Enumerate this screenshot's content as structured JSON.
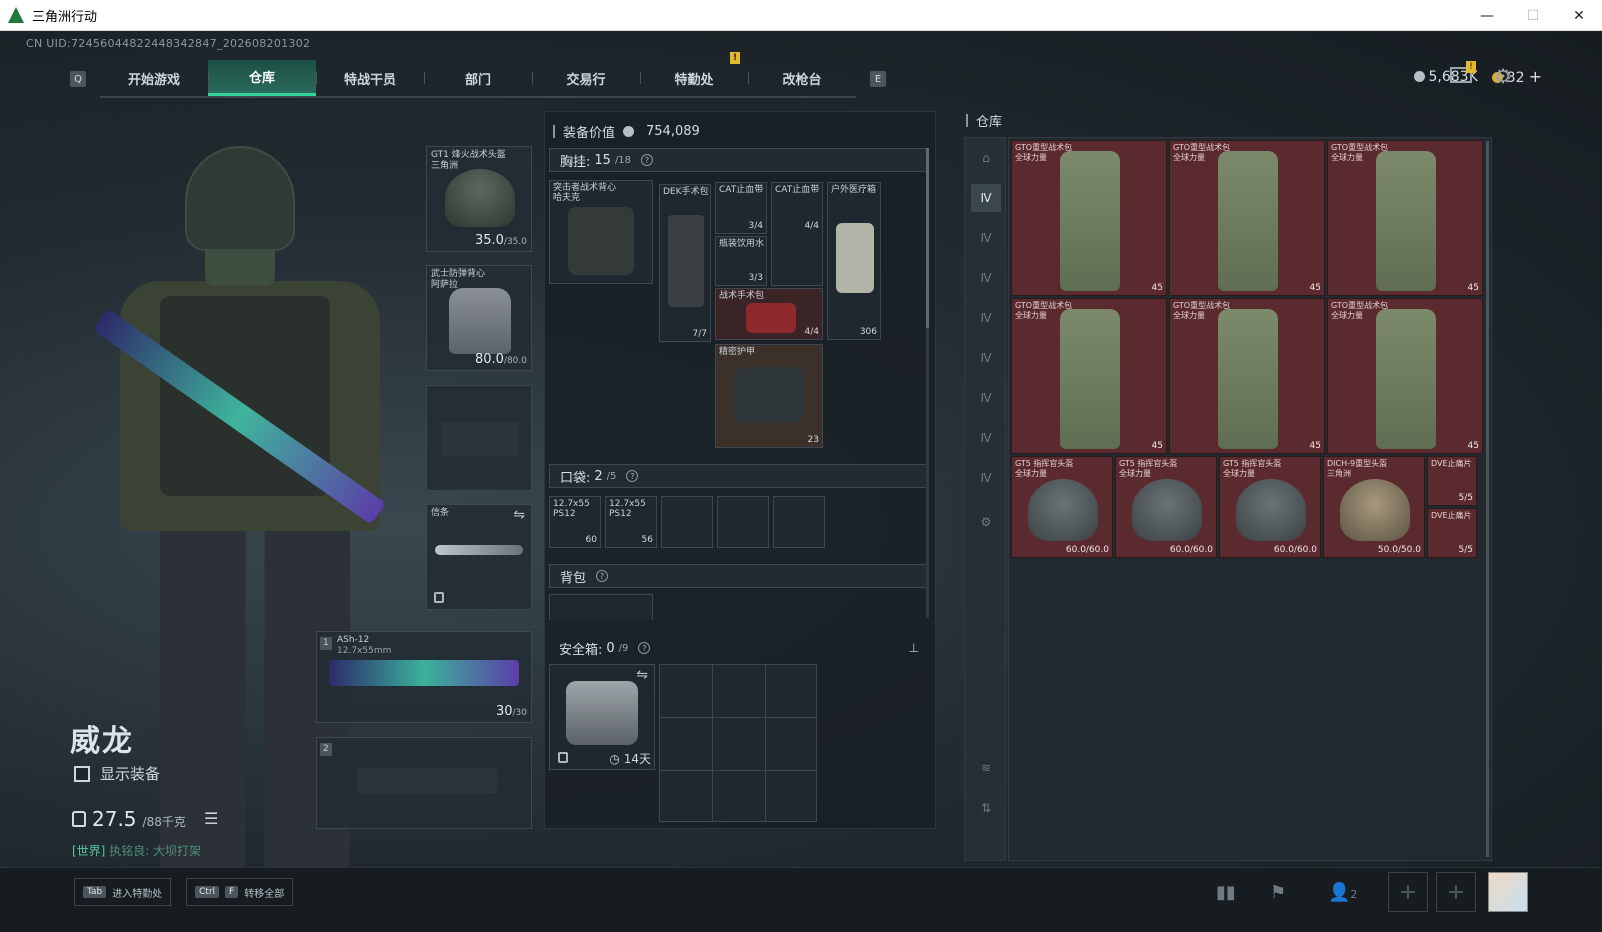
{
  "window": {
    "title": "三角洲行动",
    "buttons": [
      "—",
      "☐",
      "✕"
    ]
  },
  "uid": "CN UID:7245604482244834284​7_202608201302",
  "nav": {
    "left_key": "Q",
    "right_key": "E",
    "tabs": [
      {
        "label": "开始游戏"
      },
      {
        "label": "仓库"
      },
      {
        "label": "特战干员"
      },
      {
        "label": "部门"
      },
      {
        "label": "交易行"
      },
      {
        "label": "特勤处"
      },
      {
        "label": "改枪台"
      }
    ],
    "notice_badge": "!"
  },
  "currency": {
    "silver": "5,683K",
    "gold": "32",
    "plus": "+",
    "mail_badge": "!"
  },
  "operator": {
    "name": "威龙",
    "show_equipment": "显示装备",
    "weight": "27.5",
    "weight_max": "/88千克",
    "world_prefix": "[世界]",
    "world_text": "执铭良: 大坝打架"
  },
  "slots": {
    "helmet": {
      "label": "GT1 烽火战术头盔\n三角洲",
      "value": "35.0",
      "max": "/35.0"
    },
    "armor": {
      "label": "武士防弹背心\n阿萨拉",
      "value": "80.0",
      "max": "/80.0"
    },
    "melee": {
      "label": "信条"
    },
    "primary": {
      "index": "1",
      "name": "ASh-12",
      "caliber": "12.7x55mm",
      "ammo": "30",
      "ammo_max": "/30"
    },
    "secondary": {
      "index": "2"
    }
  },
  "middle": {
    "value_label": "装备价值",
    "value": "754,089",
    "chest_rig": {
      "label": "胸挂:",
      "used": "15",
      "cap": "/18",
      "help": "?"
    },
    "rig_item": {
      "label": "突击者战术背心\n哈夫克"
    },
    "items": [
      {
        "label": "DEK手术包",
        "count": "7/7"
      },
      {
        "label": "CAT止血带",
        "count": "3/4"
      },
      {
        "label": "CAT止血带",
        "count": "4/4"
      },
      {
        "label": "户外医疗箱",
        "count": "306"
      },
      {
        "label": "瓶装饮用水",
        "count": "3/3"
      },
      {
        "label": "战术手术包",
        "count": "4/4"
      },
      {
        "label": "精密护甲",
        "count": "23"
      }
    ],
    "pocket": {
      "label": "口袋:",
      "used": "2",
      "cap": "/5",
      "help": "?"
    },
    "pocket_items": [
      {
        "label": "12.7x55\nPS12",
        "count": "60"
      },
      {
        "label": "12.7x55\nPS12",
        "count": "56"
      }
    ],
    "backpack": {
      "label": "背包",
      "help": "?"
    },
    "safebox": {
      "label": "安全箱:",
      "used": "0",
      "cap": "/9",
      "help": "?",
      "days": "14天"
    }
  },
  "warehouse": {
    "title": "仓库",
    "side_icons": [
      "home-icon",
      "ammo-icon",
      "gun-icon",
      "gun-icon",
      "gun-icon",
      "armor-icon",
      "armor-icon",
      "helmet-icon",
      "helmet-icon",
      "settings-icon"
    ],
    "bags": [
      {
        "label": "GTO重型战术包\n全球力量",
        "count": "45"
      },
      {
        "label": "GTO重型战术包\n全球力量",
        "count": "45"
      },
      {
        "label": "GTO重型战术包\n全球力量",
        "count": "45"
      },
      {
        "label": "GTO重型战术包\n全球力量",
        "count": "45"
      },
      {
        "label": "GTO重型战术包\n全球力量",
        "count": "45"
      },
      {
        "label": "GTO重型战术包\n全球力量",
        "count": "45"
      }
    ],
    "helmets": [
      {
        "label": "GT5 指挥官头盔\n全球力量",
        "count": "60.0/60.0"
      },
      {
        "label": "GT5 指挥官头盔\n全球力量",
        "count": "60.0/60.0"
      },
      {
        "label": "GT5 指挥官头盔\n全球力量",
        "count": "60.0/60.0"
      },
      {
        "label": "DICH-9重型头盔\n三角洲",
        "count": "50.0/50.0"
      }
    ],
    "small_items": [
      {
        "label": "DVE止痛片",
        "count": "5/5"
      },
      {
        "label": "DVE止痛片",
        "count": "5/5"
      }
    ]
  },
  "bottom": {
    "hint1_key": "Tab",
    "hint1_text": "进入特勤处",
    "hint2_key1": "Ctrl",
    "hint2_key2": "F",
    "hint2_text": "转移全部",
    "party_count": "2"
  }
}
